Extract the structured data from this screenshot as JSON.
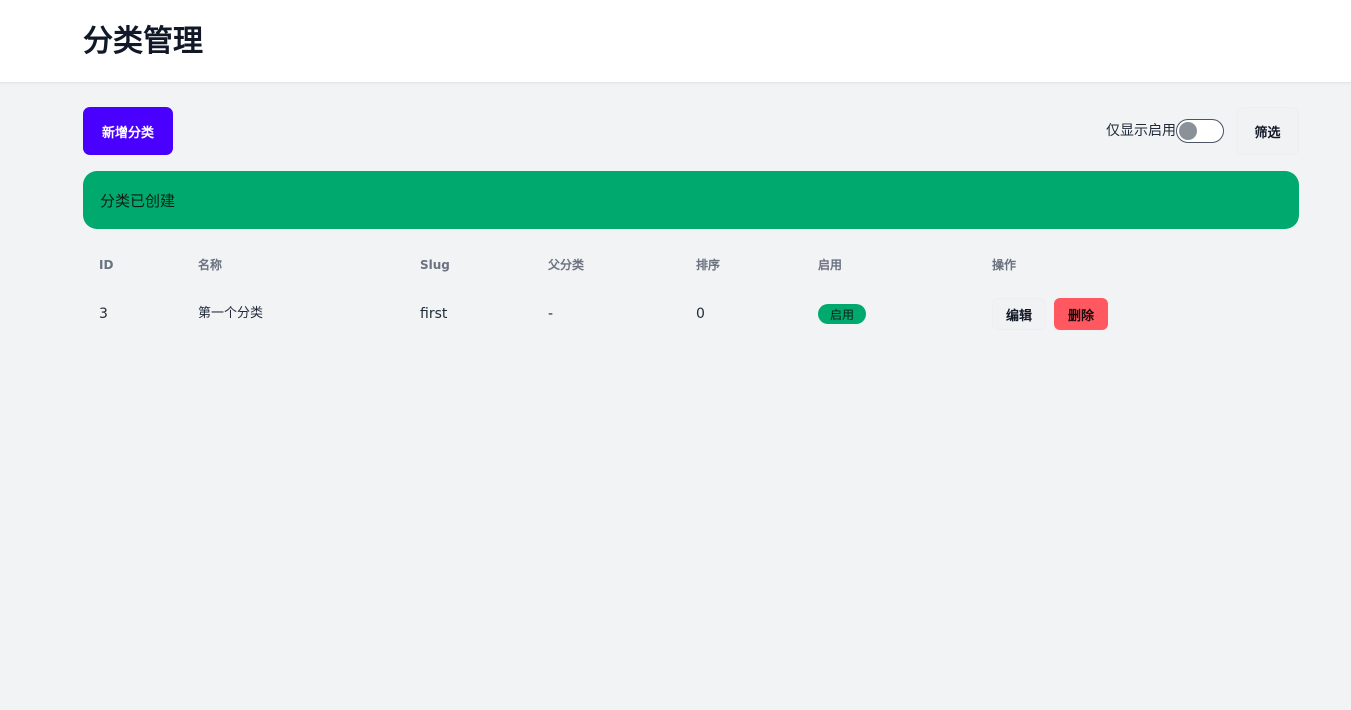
{
  "header": {
    "title": "分类管理"
  },
  "toolbar": {
    "add_label": "新增分类",
    "toggle_label": "仅显示启用",
    "toggle_on": false,
    "filter_label": "筛选"
  },
  "alert": {
    "message": "分类已创建",
    "color": "#00a96e"
  },
  "table": {
    "columns": [
      "ID",
      "名称",
      "Slug",
      "父分类",
      "排序",
      "启用",
      "操作"
    ],
    "rows": [
      {
        "id": "3",
        "name": "第一个分类",
        "slug": "first",
        "parent": "-",
        "order": "0",
        "status": "启用",
        "edit_label": "编辑",
        "delete_label": "删除"
      }
    ]
  },
  "colors": {
    "primary": "#4a00ff",
    "success": "#00a96e",
    "danger": "#ff5861",
    "background": "#f2f3f5"
  }
}
